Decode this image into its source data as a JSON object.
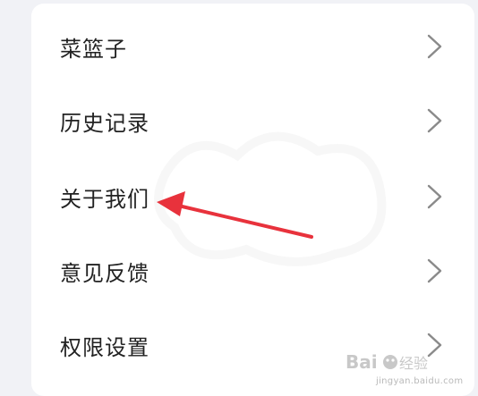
{
  "menu": {
    "items": [
      {
        "label": "菜篮子",
        "icon": "chevron-right-icon"
      },
      {
        "label": "历史记录",
        "icon": "chevron-right-icon"
      },
      {
        "label": "关于我们",
        "icon": "chevron-right-icon"
      },
      {
        "label": "意见反馈",
        "icon": "chevron-right-icon"
      },
      {
        "label": "权限设置",
        "icon": "chevron-right-icon"
      }
    ]
  },
  "annotation": {
    "color": "#e8323c",
    "icon": "red-arrow-annotation"
  },
  "watermark": {
    "text": "jingyan.baidu.com",
    "logo": "Baidu经验"
  },
  "colors": {
    "background": "#f1f2f6",
    "card": "#ffffff",
    "text": "#222222",
    "chevron": "#8a8a8a"
  }
}
